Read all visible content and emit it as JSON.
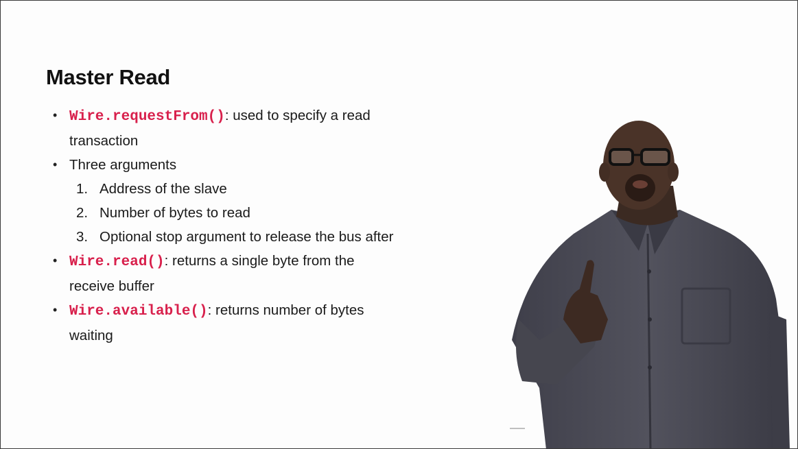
{
  "slide": {
    "title": "Master Read",
    "bullets": [
      {
        "code": "Wire.requestFrom()",
        "text": ": used to specify a read",
        "text2": "transaction"
      },
      {
        "text": "Three arguments",
        "subitems": [
          {
            "num": "1.",
            "text": "Address of the slave"
          },
          {
            "num": "2.",
            "text": "Number of bytes to read"
          },
          {
            "num": "3.",
            "text": "Optional stop argument to release the bus after"
          }
        ]
      },
      {
        "code": "Wire.read()",
        "text": ": returns a single byte from the",
        "text2": "receive buffer"
      },
      {
        "code": "Wire.available()",
        "text": ": returns number of bytes",
        "text2": "waiting"
      }
    ]
  },
  "colors": {
    "code": "#d8204c",
    "shirt": "#4a4a55",
    "background": "#fdfdfd"
  }
}
